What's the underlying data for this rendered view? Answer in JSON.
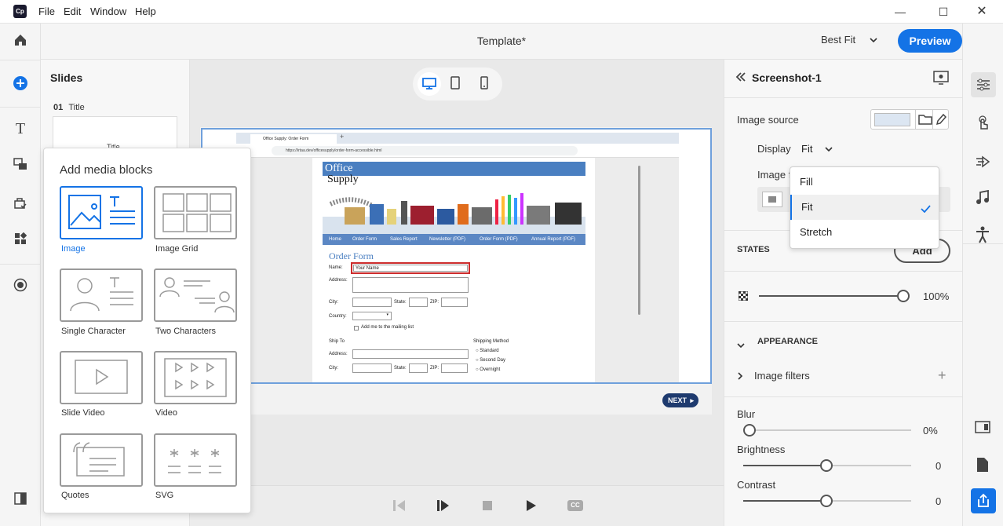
{
  "app": {
    "logo_text": "Cp",
    "menu": [
      "File",
      "Edit",
      "Window",
      "Help"
    ]
  },
  "topbar": {
    "doc_title": "Template*",
    "fit_label": "Best Fit",
    "preview_label": "Preview",
    "more_label": "•••"
  },
  "slides": {
    "heading": "Slides",
    "slide1_number": "01",
    "slide1_label": "Title",
    "slide1_thumb_text": "Title"
  },
  "media_popup": {
    "heading": "Add media blocks",
    "tiles": [
      "Image",
      "Image Grid",
      "Single Character",
      "Two Characters",
      "Slide Video",
      "Video",
      "Quotes",
      "SVG"
    ]
  },
  "embedded_page": {
    "tab_title": "Office Supply: Order Form",
    "url": "https://irtaa.dev/officesupply/order-form-accessible.html",
    "brand_line1": "Office",
    "brand_line2": "Supply",
    "nav": [
      "Home",
      "Order Form",
      "Sales Report",
      "Newsletter (PDF)",
      "Order Form (PDF)",
      "Annual Report (PDF)"
    ],
    "form_title": "Order Form",
    "name_label": "Name:",
    "name_value": "Your Name",
    "address_label": "Address:",
    "city_label": "City:",
    "state_label": "State:",
    "zip_label": "ZIP:",
    "country_label": "Country:",
    "mailing_label": "Add me to the mailing list",
    "ship_to": "Ship To",
    "shipping_method": "Shipping Method",
    "ship_options": [
      "Standard",
      "Second Day",
      "Overnight"
    ],
    "address2_label": "Address:",
    "city2_label": "City:",
    "state2_label": "State:",
    "zip2_label": "ZIP:"
  },
  "canvas": {
    "next_label": "NEXT"
  },
  "properties": {
    "title": "Screenshot-1",
    "image_source": "Image source",
    "display_label": "Display",
    "display_value": "Fit",
    "image_f_label": "Image f",
    "states_label": "STATES",
    "add_label": "Add",
    "opacity_value": "100%",
    "appearance_label": "APPEARANCE",
    "image_filters_label": "Image filters",
    "blur_label": "Blur",
    "blur_value": "0%",
    "brightness_label": "Brightness",
    "brightness_value": "0",
    "contrast_label": "Contrast",
    "contrast_value": "0"
  },
  "display_dropdown": {
    "options": [
      "Fill",
      "Fit",
      "Stretch"
    ],
    "selected": "Fit"
  },
  "colors": {
    "accent": "#1473e6",
    "brand_bar": "#4a7fc1"
  }
}
